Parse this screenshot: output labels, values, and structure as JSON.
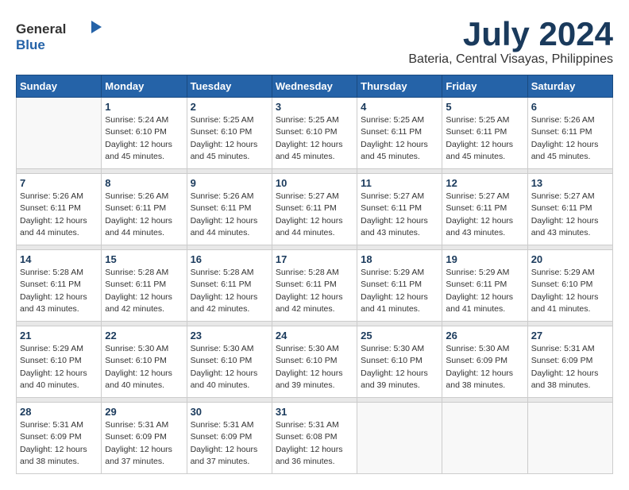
{
  "logo": {
    "general": "General",
    "blue": "Blue"
  },
  "title": "July 2024",
  "subtitle": "Bateria, Central Visayas, Philippines",
  "days_of_week": [
    "Sunday",
    "Monday",
    "Tuesday",
    "Wednesday",
    "Thursday",
    "Friday",
    "Saturday"
  ],
  "weeks": [
    [
      {
        "day": "",
        "info": ""
      },
      {
        "day": "1",
        "info": "Sunrise: 5:24 AM\nSunset: 6:10 PM\nDaylight: 12 hours\nand 45 minutes."
      },
      {
        "day": "2",
        "info": "Sunrise: 5:25 AM\nSunset: 6:10 PM\nDaylight: 12 hours\nand 45 minutes."
      },
      {
        "day": "3",
        "info": "Sunrise: 5:25 AM\nSunset: 6:10 PM\nDaylight: 12 hours\nand 45 minutes."
      },
      {
        "day": "4",
        "info": "Sunrise: 5:25 AM\nSunset: 6:11 PM\nDaylight: 12 hours\nand 45 minutes."
      },
      {
        "day": "5",
        "info": "Sunrise: 5:25 AM\nSunset: 6:11 PM\nDaylight: 12 hours\nand 45 minutes."
      },
      {
        "day": "6",
        "info": "Sunrise: 5:26 AM\nSunset: 6:11 PM\nDaylight: 12 hours\nand 45 minutes."
      }
    ],
    [
      {
        "day": "7",
        "info": "Sunrise: 5:26 AM\nSunset: 6:11 PM\nDaylight: 12 hours\nand 44 minutes."
      },
      {
        "day": "8",
        "info": "Sunrise: 5:26 AM\nSunset: 6:11 PM\nDaylight: 12 hours\nand 44 minutes."
      },
      {
        "day": "9",
        "info": "Sunrise: 5:26 AM\nSunset: 6:11 PM\nDaylight: 12 hours\nand 44 minutes."
      },
      {
        "day": "10",
        "info": "Sunrise: 5:27 AM\nSunset: 6:11 PM\nDaylight: 12 hours\nand 44 minutes."
      },
      {
        "day": "11",
        "info": "Sunrise: 5:27 AM\nSunset: 6:11 PM\nDaylight: 12 hours\nand 43 minutes."
      },
      {
        "day": "12",
        "info": "Sunrise: 5:27 AM\nSunset: 6:11 PM\nDaylight: 12 hours\nand 43 minutes."
      },
      {
        "day": "13",
        "info": "Sunrise: 5:27 AM\nSunset: 6:11 PM\nDaylight: 12 hours\nand 43 minutes."
      }
    ],
    [
      {
        "day": "14",
        "info": "Sunrise: 5:28 AM\nSunset: 6:11 PM\nDaylight: 12 hours\nand 43 minutes."
      },
      {
        "day": "15",
        "info": "Sunrise: 5:28 AM\nSunset: 6:11 PM\nDaylight: 12 hours\nand 42 minutes."
      },
      {
        "day": "16",
        "info": "Sunrise: 5:28 AM\nSunset: 6:11 PM\nDaylight: 12 hours\nand 42 minutes."
      },
      {
        "day": "17",
        "info": "Sunrise: 5:28 AM\nSunset: 6:11 PM\nDaylight: 12 hours\nand 42 minutes."
      },
      {
        "day": "18",
        "info": "Sunrise: 5:29 AM\nSunset: 6:11 PM\nDaylight: 12 hours\nand 41 minutes."
      },
      {
        "day": "19",
        "info": "Sunrise: 5:29 AM\nSunset: 6:11 PM\nDaylight: 12 hours\nand 41 minutes."
      },
      {
        "day": "20",
        "info": "Sunrise: 5:29 AM\nSunset: 6:10 PM\nDaylight: 12 hours\nand 41 minutes."
      }
    ],
    [
      {
        "day": "21",
        "info": "Sunrise: 5:29 AM\nSunset: 6:10 PM\nDaylight: 12 hours\nand 40 minutes."
      },
      {
        "day": "22",
        "info": "Sunrise: 5:30 AM\nSunset: 6:10 PM\nDaylight: 12 hours\nand 40 minutes."
      },
      {
        "day": "23",
        "info": "Sunrise: 5:30 AM\nSunset: 6:10 PM\nDaylight: 12 hours\nand 40 minutes."
      },
      {
        "day": "24",
        "info": "Sunrise: 5:30 AM\nSunset: 6:10 PM\nDaylight: 12 hours\nand 39 minutes."
      },
      {
        "day": "25",
        "info": "Sunrise: 5:30 AM\nSunset: 6:10 PM\nDaylight: 12 hours\nand 39 minutes."
      },
      {
        "day": "26",
        "info": "Sunrise: 5:30 AM\nSunset: 6:09 PM\nDaylight: 12 hours\nand 38 minutes."
      },
      {
        "day": "27",
        "info": "Sunrise: 5:31 AM\nSunset: 6:09 PM\nDaylight: 12 hours\nand 38 minutes."
      }
    ],
    [
      {
        "day": "28",
        "info": "Sunrise: 5:31 AM\nSunset: 6:09 PM\nDaylight: 12 hours\nand 38 minutes."
      },
      {
        "day": "29",
        "info": "Sunrise: 5:31 AM\nSunset: 6:09 PM\nDaylight: 12 hours\nand 37 minutes."
      },
      {
        "day": "30",
        "info": "Sunrise: 5:31 AM\nSunset: 6:09 PM\nDaylight: 12 hours\nand 37 minutes."
      },
      {
        "day": "31",
        "info": "Sunrise: 5:31 AM\nSunset: 6:08 PM\nDaylight: 12 hours\nand 36 minutes."
      },
      {
        "day": "",
        "info": ""
      },
      {
        "day": "",
        "info": ""
      },
      {
        "day": "",
        "info": ""
      }
    ]
  ]
}
